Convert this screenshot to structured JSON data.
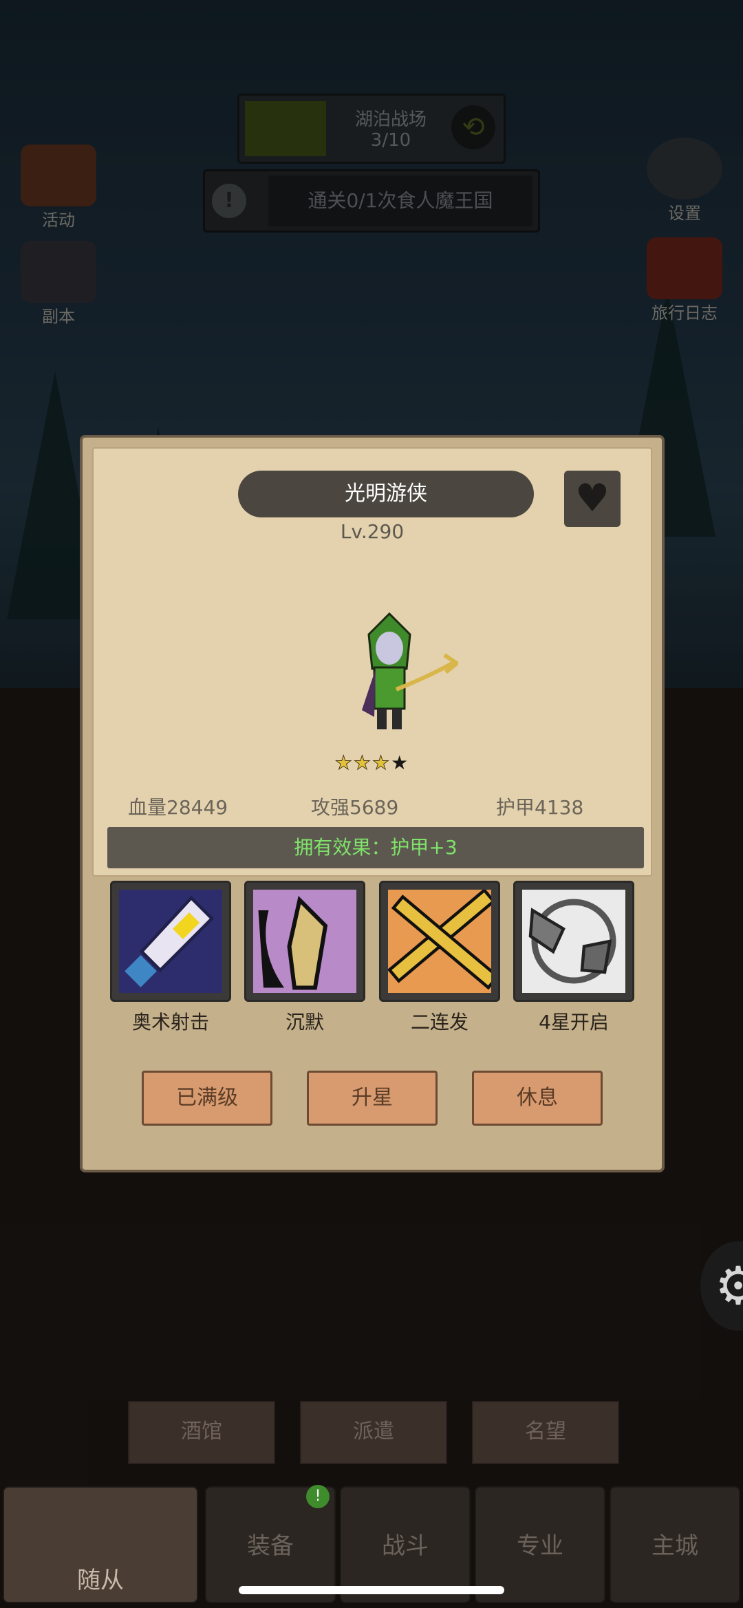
{
  "hud": {
    "stage_name": "湖泊战场",
    "stage_progress": "3/10",
    "stage_progress_fraction": 0.3,
    "goal_text": "通关0/1次食人魔王国",
    "left_icons": [
      "活动",
      "副本"
    ],
    "right_icons": [
      "设置",
      "旅行日志"
    ]
  },
  "hero": {
    "name": "光明游侠",
    "level": "Lv.290",
    "stars_filled": 3,
    "stars_total": 4,
    "hp": "血量28449",
    "attack": "攻强5689",
    "armor": "护甲4138",
    "effect": "拥有效果：护甲+3"
  },
  "skills": [
    {
      "name": "奥术射击",
      "icon": "arcane-shot-icon"
    },
    {
      "name": "沉默",
      "icon": "silence-icon"
    },
    {
      "name": "二连发",
      "icon": "double-shot-icon"
    },
    {
      "name": "4星开启",
      "icon": "locked-skill-icon"
    }
  ],
  "actions": {
    "max_level": "已满级",
    "upgrade_star": "升星",
    "rest": "休息"
  },
  "submenu": [
    "酒馆",
    "派遣",
    "名望"
  ],
  "tabs": [
    "随从",
    "装备",
    "战斗",
    "专业",
    "主城"
  ],
  "colors": {
    "effect_text": "#7fe36a",
    "star_gold": "#e2c23a"
  }
}
